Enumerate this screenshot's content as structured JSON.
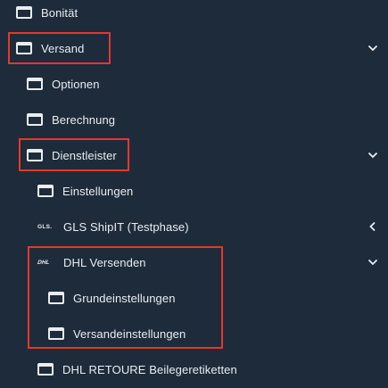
{
  "nav": {
    "items": [
      {
        "label": "Bonität",
        "icon": "window-icon"
      },
      {
        "label": "Versand",
        "icon": "window-icon",
        "chevron": "chevron-down-icon"
      },
      {
        "label": "Optionen",
        "icon": "window-icon"
      },
      {
        "label": "Berechnung",
        "icon": "window-icon"
      },
      {
        "label": "Dienstleister",
        "icon": "window-icon",
        "chevron": "chevron-down-icon"
      },
      {
        "label": "Einstellungen",
        "icon": "window-icon"
      },
      {
        "label": "GLS ShipIT (Testphase)",
        "icon": "gls-logo-icon",
        "icon_text": "GLS.",
        "chevron": "chevron-left-icon"
      },
      {
        "label": "DHL Versenden",
        "icon": "dhl-logo-icon",
        "icon_text": "DHL",
        "chevron": "chevron-down-icon"
      },
      {
        "label": "Grundeinstellungen",
        "icon": "window-icon"
      },
      {
        "label": "Versandeinstellungen",
        "icon": "window-icon"
      },
      {
        "label": "DHL RETOURE Beilegeretiketten",
        "icon": "window-icon"
      }
    ]
  },
  "colors": {
    "background": "#1e2b3a",
    "text": "#e9edf2",
    "highlight": "#e8372b"
  }
}
